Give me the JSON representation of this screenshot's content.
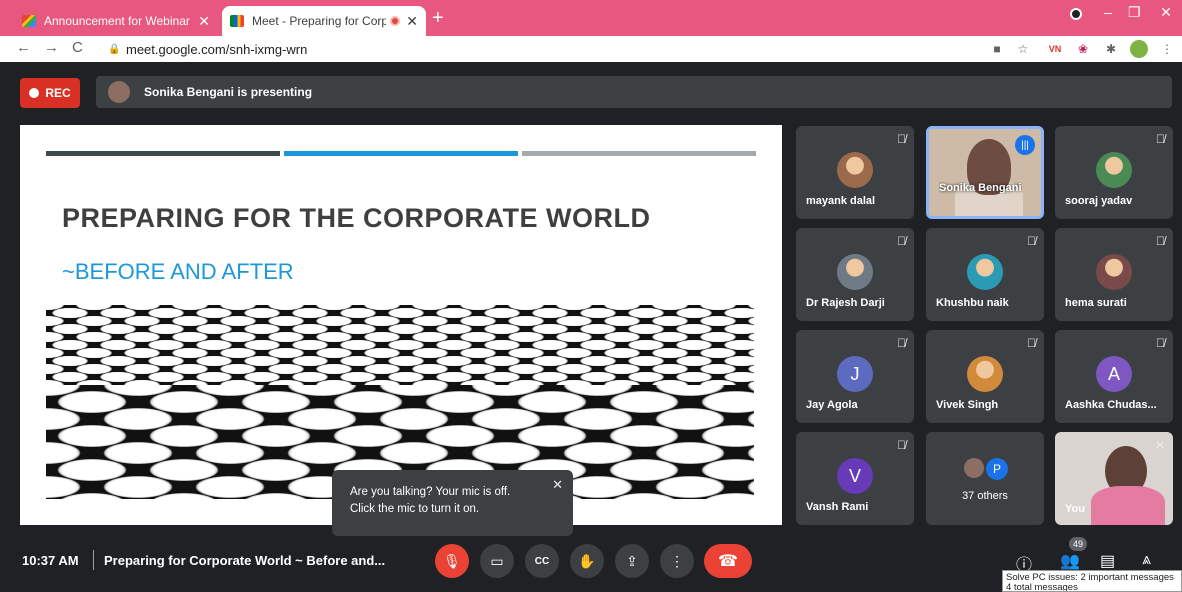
{
  "browser": {
    "tabs": [
      {
        "title": "Announcement for Webinar - jig",
        "active": false,
        "icon": "gmail-icon"
      },
      {
        "title": "Meet - Preparing for Corpora",
        "active": true,
        "icon": "meet-icon",
        "recording": true
      }
    ],
    "url": "meet.google.com/snh-ixmg-wrn",
    "window_controls": [
      "–",
      "❐",
      "✕"
    ]
  },
  "meet": {
    "rec_label": "REC",
    "presenting_text": "Sonika Bengani is presenting",
    "slide": {
      "title": "PREPARING FOR THE CORPORATE WORLD",
      "subtitle": "~BEFORE AND AFTER",
      "stripe_colors": [
        "#3f4a4f",
        "#1c98d8",
        "#a6a9ab"
      ]
    },
    "participants": [
      {
        "name": "mayank dalal",
        "avatar": "photo",
        "color": "#9a6a4a"
      },
      {
        "name": "Sonika Bengani",
        "avatar": "video",
        "speaking": true
      },
      {
        "name": "sooraj yadav",
        "avatar": "photo",
        "color": "#4a8a55"
      },
      {
        "name": "Dr Rajesh Darji",
        "avatar": "photo",
        "color": "#6e7a86"
      },
      {
        "name": "Khushbu naik",
        "avatar": "photo",
        "color": "#2b9bb5"
      },
      {
        "name": "hema surati",
        "avatar": "photo",
        "color": "#7a4a4a"
      },
      {
        "name": "Jay Agola",
        "avatar": "letter",
        "letter": "J",
        "color": "#5c6bc0"
      },
      {
        "name": "Vivek Singh",
        "avatar": "photo",
        "color": "#d08a3a"
      },
      {
        "name": "Aashka Chudas...",
        "avatar": "letter",
        "letter": "A",
        "color": "#7e57c2"
      },
      {
        "name": "Vansh Rami",
        "avatar": "letter",
        "letter": "V",
        "color": "#673ab7"
      },
      {
        "name": "37 others",
        "avatar": "group",
        "letter": "P",
        "color": "#1a73e8"
      },
      {
        "name": "You",
        "avatar": "self"
      }
    ],
    "toast": {
      "line1": "Are you talking? Your mic is off.",
      "line2": "Click the mic to turn it on."
    },
    "bottom": {
      "time": "10:37 AM",
      "meeting_title": "Preparing for Corporate World ~ Before and...",
      "participant_count": "49"
    },
    "tooltip": {
      "line1": "Solve PC issues: 2 important messages",
      "line2": "4 total messages"
    }
  }
}
